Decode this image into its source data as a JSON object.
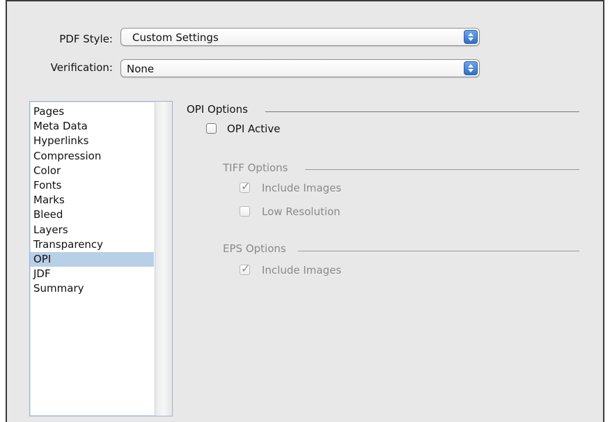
{
  "pdf_style": {
    "label": "PDF Style:",
    "value": "Custom Settings"
  },
  "verification": {
    "label": "Verification:",
    "value": "None"
  },
  "sidebar": {
    "items": [
      {
        "label": "Pages"
      },
      {
        "label": "Meta Data"
      },
      {
        "label": "Hyperlinks"
      },
      {
        "label": "Compression"
      },
      {
        "label": "Color"
      },
      {
        "label": "Fonts"
      },
      {
        "label": "Marks"
      },
      {
        "label": "Bleed"
      },
      {
        "label": "Layers"
      },
      {
        "label": "Transparency"
      },
      {
        "label": "OPI",
        "selected": true
      },
      {
        "label": "JDF"
      },
      {
        "label": "Summary"
      }
    ]
  },
  "opi": {
    "section_title": "OPI Options",
    "active": {
      "label": "OPI Active",
      "checked": false
    },
    "tiff": {
      "title": "TIFF Options",
      "include_images": {
        "label": "Include Images",
        "checked": true,
        "enabled": false
      },
      "low_resolution": {
        "label": "Low Resolution",
        "checked": false,
        "enabled": false
      }
    },
    "eps": {
      "title": "EPS Options",
      "include_images": {
        "label": "Include Images",
        "checked": true,
        "enabled": false
      }
    }
  },
  "colors": {
    "selection": "#b8cfe8",
    "accent": "#2d6fcf",
    "disabled_text": "#8a8a8a"
  }
}
